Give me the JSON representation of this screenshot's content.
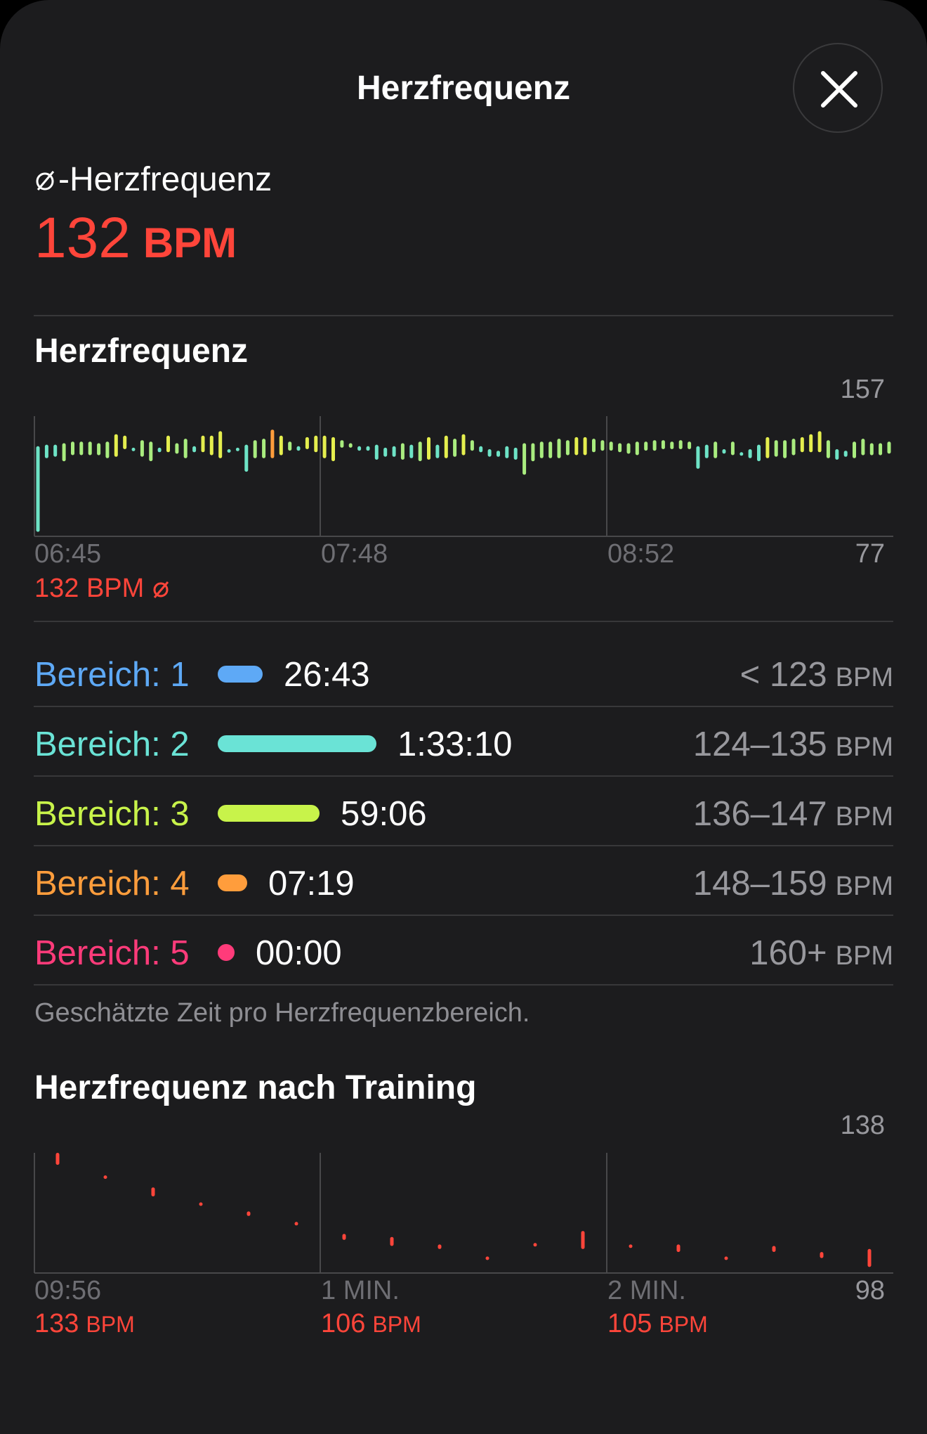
{
  "header": {
    "title": "Herzfrequenz",
    "close_icon": "close-icon"
  },
  "average": {
    "label": "-Herzfrequenz",
    "value": "132",
    "unit": "BPM",
    "symbol_icon": "diameter-icon"
  },
  "hr_chart": {
    "title": "Herzfrequenz",
    "max_label": "157",
    "min_label": "77",
    "x_labels": [
      "06:45",
      "07:48",
      "08:52"
    ],
    "avg_text": "132 BPM",
    "avg_icon": "diameter-icon"
  },
  "zones": [
    {
      "name": "Bereich: 1",
      "time": "26:43",
      "range": "< 123",
      "unit": "BPM",
      "color": "#5ea9f6",
      "share": 0.15
    },
    {
      "name": "Bereich: 2",
      "time": "1:33:10",
      "range": "124–135",
      "unit": "BPM",
      "color": "#6ae3d6",
      "share": 0.53
    },
    {
      "name": "Bereich: 3",
      "time": "59:06",
      "range": "136–147",
      "unit": "BPM",
      "color": "#c8f34a",
      "share": 0.34
    },
    {
      "name": "Bereich: 4",
      "time": "07:19",
      "range": "148–159",
      "unit": "BPM",
      "color": "#ff9d3c",
      "share": 0.04
    },
    {
      "name": "Bereich: 5",
      "time": "00:00",
      "range": "160+",
      "unit": "BPM",
      "color": "#ff3b7a",
      "share": 0.0
    }
  ],
  "zones_note": "Geschätzte Zeit pro Herzfrequenzbereich.",
  "recovery": {
    "title": "Herzfrequenz nach Training",
    "max_label": "138",
    "min_label": "98",
    "x_labels": [
      "09:56",
      "1 MIN.",
      "2 MIN."
    ],
    "values": [
      {
        "value": "133",
        "unit": "BPM"
      },
      {
        "value": "106",
        "unit": "BPM"
      },
      {
        "value": "105",
        "unit": "BPM"
      }
    ]
  },
  "chart_data": [
    {
      "type": "bar",
      "title": "Herzfrequenz",
      "ylim": [
        77,
        157
      ],
      "x_ticks": [
        "06:45",
        "07:48",
        "08:52"
      ],
      "average": 132,
      "series": [
        {
          "lo": [
            80,
            129,
            130,
            127,
            131,
            131,
            131,
            131,
            129,
            130,
            135,
            135,
            130,
            127,
            133,
            133,
            132,
            129,
            133,
            133,
            131,
            129,
            135,
            135,
            120,
            129,
            129,
            129,
            131,
            134,
            134,
            135,
            133,
            129,
            127,
            136,
            136,
            134,
            134,
            128,
            130,
            130,
            128,
            129,
            127,
            128,
            129,
            129,
            130,
            131,
            134,
            133,
            130,
            130,
            129,
            128,
            118,
            127,
            129,
            129,
            129,
            131,
            131,
            131,
            133,
            134,
            134,
            133,
            132,
            131,
            134,
            134,
            135,
            135,
            135,
            135,
            122,
            129,
            129,
            132,
            131,
            131,
            129,
            127,
            129,
            130,
            129,
            131,
            133,
            133,
            133,
            129,
            128,
            130,
            129,
            131,
            131,
            131,
            132
          ],
          "hi": [
            137,
            138,
            138,
            139,
            140,
            140,
            140,
            139,
            140,
            145,
            144,
            136,
            141,
            140,
            136,
            144,
            139,
            142,
            137,
            144,
            144,
            147,
            135,
            136,
            138,
            141,
            142,
            148,
            144,
            140,
            137,
            143,
            144,
            144,
            143,
            141,
            139,
            137,
            137,
            138,
            136,
            137,
            139,
            138,
            140,
            143,
            138,
            144,
            142,
            145,
            141,
            137,
            135,
            134,
            137,
            136,
            139,
            139,
            140,
            140,
            142,
            141,
            143,
            143,
            142,
            141,
            140,
            139,
            139,
            140,
            140,
            141,
            141,
            140,
            141,
            140,
            137,
            138,
            140,
            135,
            140,
            133,
            135,
            138,
            143,
            141,
            141,
            142,
            143,
            145,
            147,
            141,
            135,
            134,
            140,
            142,
            139,
            139,
            140
          ]
        }
      ]
    },
    {
      "type": "bar",
      "title": "Herzfrequenz nach Training",
      "ylim": [
        98,
        138
      ],
      "x_ticks": [
        "09:56",
        "1 MIN.",
        "2 MIN."
      ],
      "series": [
        {
          "lo": [
            134,
            130,
            123.5,
            121,
            117,
            114,
            109,
            107,
            106,
            103,
            107.5,
            106,
            107,
            105,
            103,
            105,
            103,
            100
          ],
          "hi": [
            138,
            130.5,
            126.5,
            121.5,
            118.5,
            115,
            111,
            110,
            107.5,
            103.5,
            108,
            112,
            107.5,
            107.5,
            103.5,
            107,
            105,
            106
          ]
        }
      ]
    }
  ]
}
